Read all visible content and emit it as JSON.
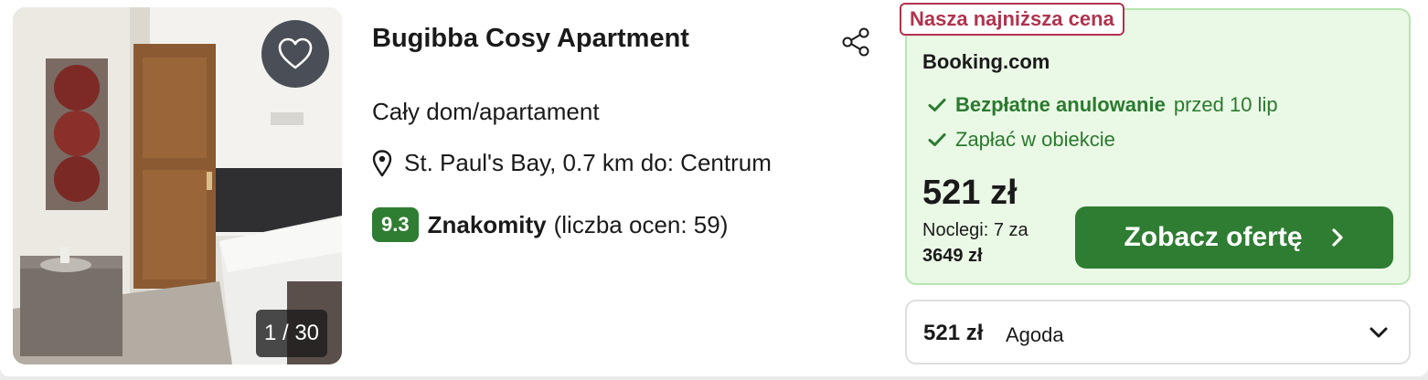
{
  "listing": {
    "title": "Bugibba Cosy Apartment",
    "type": "Cały dom/apartament",
    "location": "St. Paul's Bay, 0.7 km do: Centrum",
    "rating_score": "9.3",
    "rating_word": "Znakomity",
    "rating_count": "(liczba ocen: 59)"
  },
  "photo": {
    "counter": "1 / 30"
  },
  "deal": {
    "badge": "Nasza najniższa cena",
    "provider": "Booking.com",
    "free_cancel": "Bezpłatne anulowanie",
    "free_cancel_until": "przed 10 lip",
    "pay_at_property": "Zapłać w obiekcie",
    "price": "521 zł",
    "nights_label": "Noclegi: 7 za",
    "total_price": "3649 zł",
    "cta_label": "Zobacz ofertę"
  },
  "other_offer": {
    "price": "521 zł",
    "provider": "Agoda"
  },
  "colors": {
    "brand_green": "#2f7d32",
    "deal_bg": "#eaf8e6",
    "badge_red": "#b0334e"
  },
  "icons": [
    "heart-icon",
    "share-icon",
    "map-pin-icon",
    "check-icon",
    "chevron-right-icon",
    "chevron-down-icon"
  ]
}
